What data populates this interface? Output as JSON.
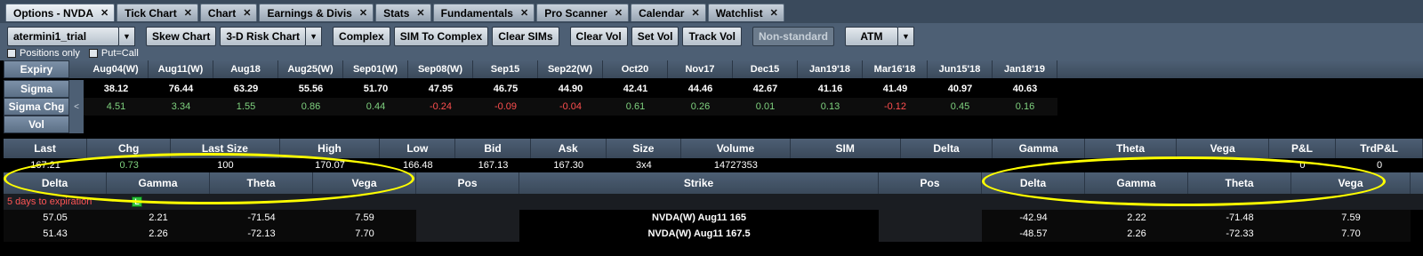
{
  "tabs": [
    {
      "label": "Options - NVDA",
      "active": true
    },
    {
      "label": "Tick Chart"
    },
    {
      "label": "Chart"
    },
    {
      "label": "Earnings & Divis"
    },
    {
      "label": "Stats"
    },
    {
      "label": "Fundamentals"
    },
    {
      "label": "Pro Scanner"
    },
    {
      "label": "Calendar"
    },
    {
      "label": "Watchlist"
    }
  ],
  "toolbar": {
    "account": "atermini1_trial",
    "skew_chart": "Skew Chart",
    "risk_chart": "3-D Risk Chart",
    "complex": "Complex",
    "sim_to_complex": "SIM To Complex",
    "clear_sims": "Clear SIMs",
    "clear_vol": "Clear Vol",
    "set_vol": "Set Vol",
    "track_vol": "Track Vol",
    "non_standard": "Non-standard",
    "atm": "ATM",
    "positions_only": "Positions only",
    "put_call": "Put=Call"
  },
  "expiry_grid": {
    "labels": {
      "expiry": "Expiry",
      "sigma": "Sigma",
      "sigma_chg": "Sigma Chg",
      "vol": "Vol"
    },
    "expiries": [
      "Aug04(W)",
      "Aug11(W)",
      "Aug18",
      "Aug25(W)",
      "Sep01(W)",
      "Sep08(W)",
      "Sep15",
      "Sep22(W)",
      "Oct20",
      "Nov17",
      "Dec15",
      "Jan19'18",
      "Mar16'18",
      "Jun15'18",
      "Jan18'19"
    ],
    "sigma": [
      "38.12",
      "76.44",
      "63.29",
      "55.56",
      "51.70",
      "47.95",
      "46.75",
      "44.90",
      "42.41",
      "44.46",
      "42.67",
      "41.16",
      "41.49",
      "40.97",
      "40.63"
    ],
    "sigma_chg": [
      "4.51",
      "3.34",
      "1.55",
      "0.86",
      "0.44",
      "-0.24",
      "-0.09",
      "-0.04",
      "0.61",
      "0.26",
      "0.01",
      "0.13",
      "-0.12",
      "0.45",
      "0.16"
    ],
    "collapse_glyph": "<"
  },
  "stats": {
    "headers": [
      "Last",
      "Chg",
      "Last Size",
      "High",
      "Low",
      "Bid",
      "Ask",
      "Size",
      "Volume",
      "SIM",
      "Delta",
      "Gamma",
      "Theta",
      "Vega",
      "P&L",
      "TrdP&L"
    ],
    "values": [
      "167.21",
      "0.73",
      "100",
      "170.07",
      "166.48",
      "167.13",
      "167.30",
      "3x4",
      "14727353",
      "",
      "",
      "",
      "",
      "",
      "0",
      "0"
    ]
  },
  "chain": {
    "headers": [
      "Delta",
      "Gamma",
      "Theta",
      "Vega",
      "Pos",
      "Strike",
      "Pos",
      "Delta",
      "Gamma",
      "Theta",
      "Vega"
    ],
    "expiration_note": "5 days to expiration",
    "badge": "L",
    "rows": [
      {
        "call_delta": "57.05",
        "call_gamma": "2.21",
        "call_theta": "-71.54",
        "call_vega": "7.59",
        "call_pos": "",
        "strike": "NVDA(W) Aug11 165",
        "put_pos": "",
        "put_delta": "-42.94",
        "put_gamma": "2.22",
        "put_theta": "-71.48",
        "put_vega": "7.59"
      },
      {
        "call_delta": "51.43",
        "call_gamma": "2.26",
        "call_theta": "-72.13",
        "call_vega": "7.70",
        "call_pos": "",
        "strike": "NVDA(W) Aug11 167.5",
        "put_pos": "",
        "put_delta": "-48.57",
        "put_gamma": "2.26",
        "put_theta": "-72.33",
        "put_vega": "7.70"
      }
    ]
  },
  "colors": {
    "highlight": "#ffff00",
    "positive": "#7fd27f",
    "negative": "#ff4f4f",
    "expiration_note": "#ff5555"
  }
}
